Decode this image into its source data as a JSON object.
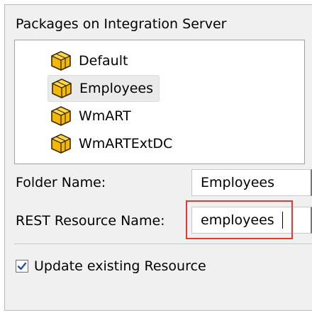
{
  "packages_section": {
    "label": "Packages on Integration Server",
    "items": [
      {
        "label": "Default",
        "icon": "package-icon",
        "selected": false
      },
      {
        "label": "Employees",
        "icon": "package-icon",
        "selected": true
      },
      {
        "label": "WmART",
        "icon": "package-icon",
        "selected": false
      },
      {
        "label": "WmARTExtDC",
        "icon": "package-icon",
        "selected": false
      }
    ]
  },
  "folder_name": {
    "label": "Folder Name:",
    "value": "Employees"
  },
  "rest_resource_name": {
    "label": "REST Resource Name:",
    "value": "employees",
    "highlight_color": "#e53935"
  },
  "update_existing": {
    "label": "Update existing Resource",
    "checked": true,
    "check_color": "#1f4fa8"
  },
  "colors": {
    "panel_bg": "#f0f0f0",
    "list_bg": "#ffffff",
    "package_icon": "#f5b800"
  }
}
